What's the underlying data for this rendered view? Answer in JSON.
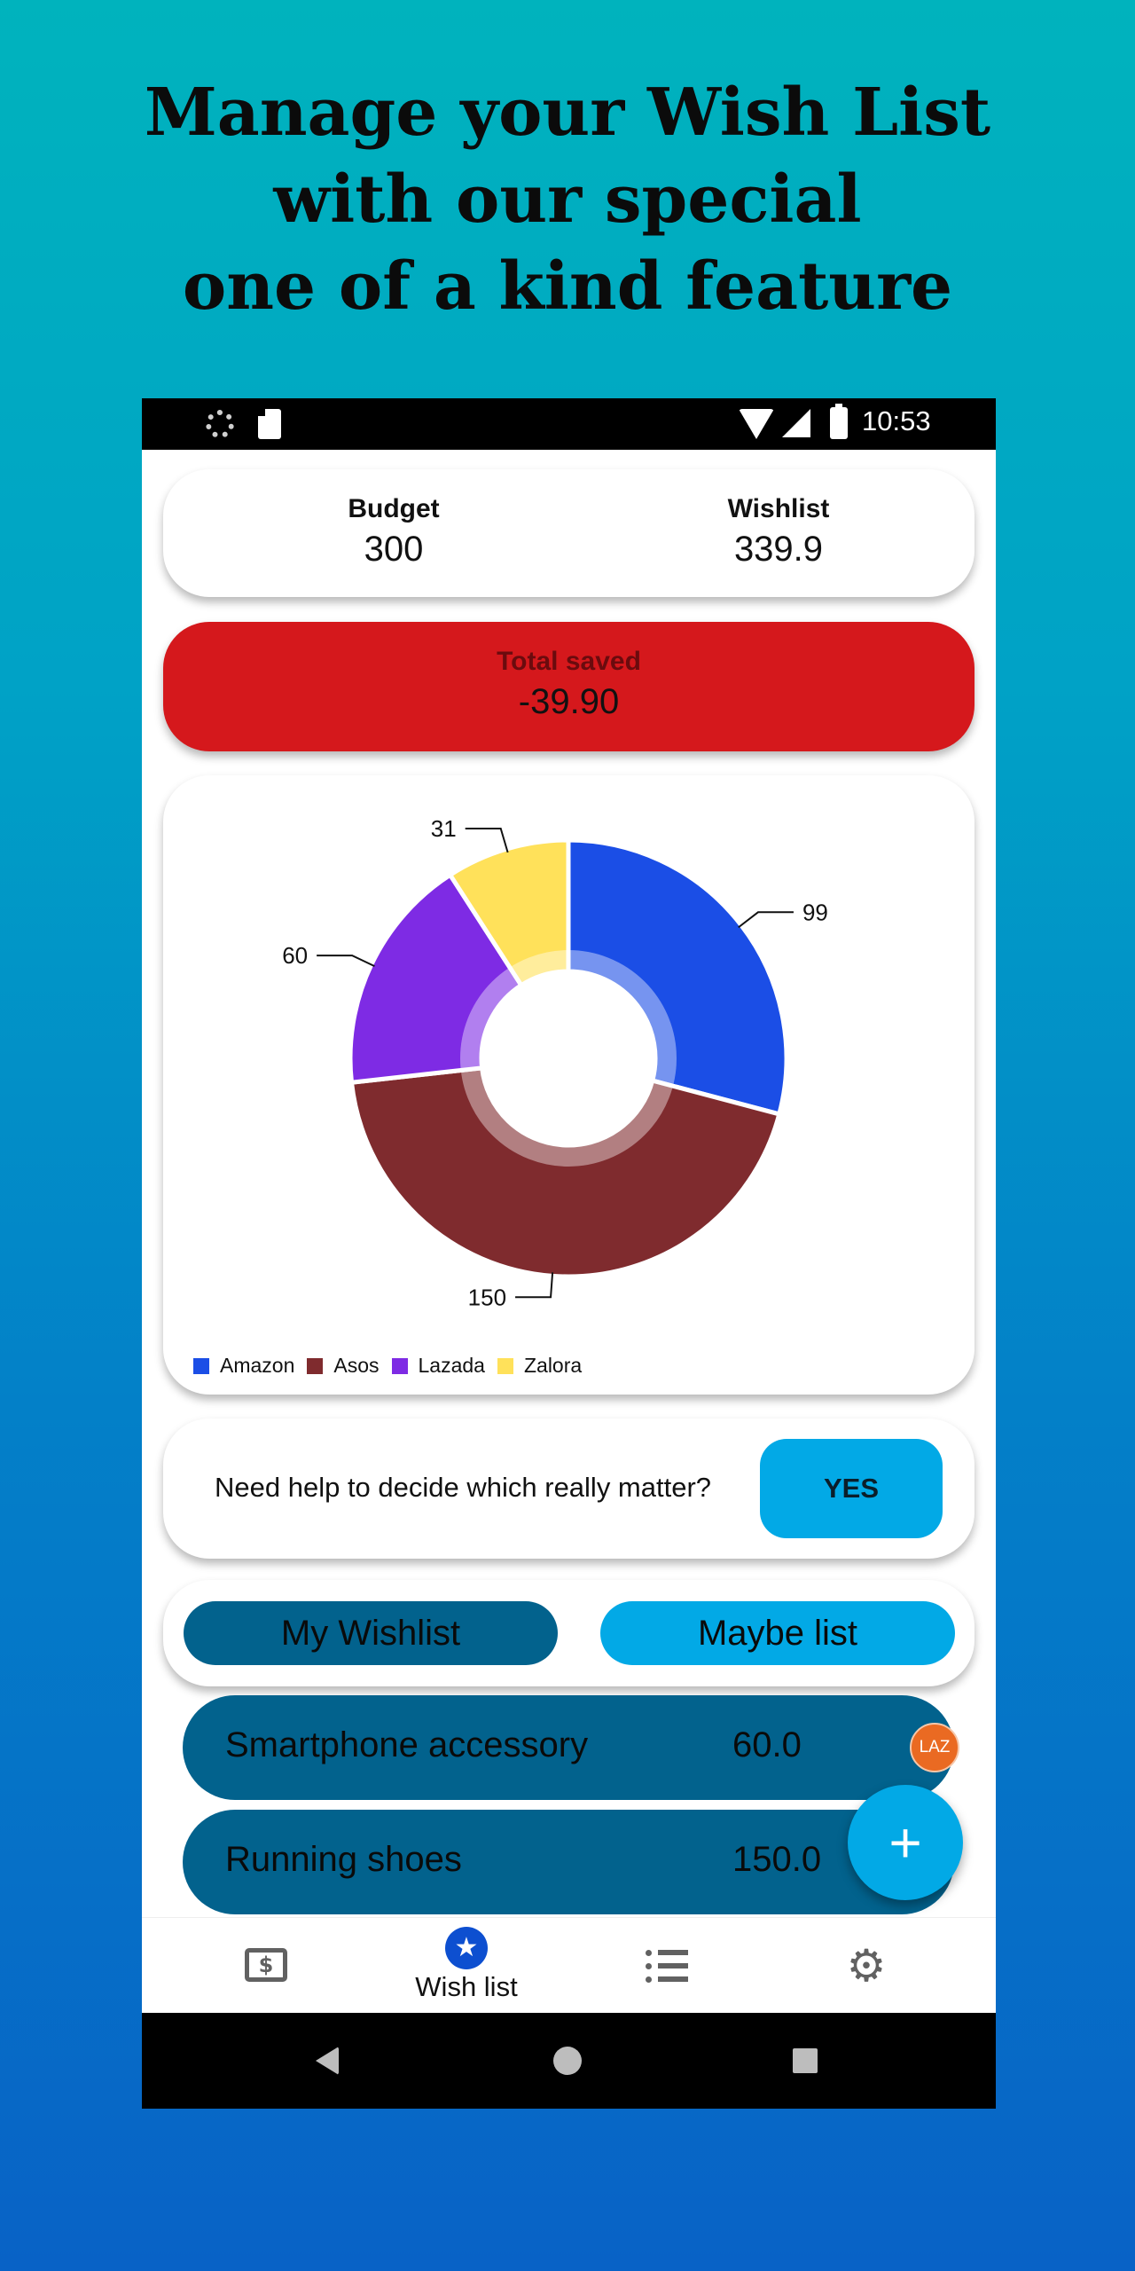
{
  "headline": {
    "line1": "Manage your Wish List",
    "line2": "with our special",
    "line3": "one of a kind feature"
  },
  "statusbar": {
    "time": "10:53",
    "icons": [
      "spinner-icon",
      "sd-card-icon",
      "wifi-icon",
      "signal-icon",
      "battery-icon"
    ]
  },
  "summary": {
    "budget_label": "Budget",
    "budget_value": "300",
    "wishlist_label": "Wishlist",
    "wishlist_value": "339.9"
  },
  "total_saved": {
    "label": "Total saved",
    "value": "-39.90",
    "color": "#d5181c"
  },
  "chart_data": {
    "type": "pie",
    "variant": "donut",
    "categories": [
      "Amazon",
      "Asos",
      "Lazada",
      "Zalora"
    ],
    "values": [
      99,
      150,
      60,
      31
    ],
    "colors": [
      "#1b4ee6",
      "#7f2b2e",
      "#7e2be4",
      "#ffe15a"
    ],
    "legend_position": "bottom-left"
  },
  "help": {
    "text": "Need help to decide which really matter?",
    "button_label": "YES"
  },
  "tabs": {
    "my_wishlist": "My Wishlist",
    "maybe_list": "Maybe list"
  },
  "wishlist_items": [
    {
      "name": "Smartphone accessory",
      "price": "60.0",
      "store_badge": "LAZ"
    },
    {
      "name": "Running shoes",
      "price": "150.0"
    }
  ],
  "fab": {
    "icon": "plus-icon",
    "glyph": "+"
  },
  "bottom_nav": {
    "items": [
      {
        "icon": "money-icon",
        "label": ""
      },
      {
        "icon": "star-icon",
        "label": "Wish list",
        "active": true
      },
      {
        "icon": "list-icon",
        "label": ""
      },
      {
        "icon": "gear-icon",
        "label": ""
      }
    ]
  },
  "colors": {
    "primary_dark": "#02628d",
    "primary_light": "#02a9e6",
    "accent_red": "#d5181c"
  }
}
